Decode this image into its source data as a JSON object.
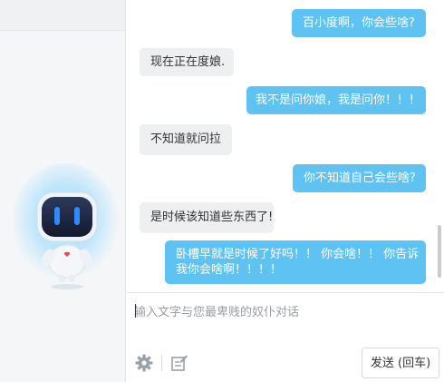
{
  "messages": [
    {
      "role": "user",
      "text": "百小度啊，你会些啥?"
    },
    {
      "role": "bot",
      "text": "现在正在度娘."
    },
    {
      "role": "user",
      "text": "我不是问你娘，我是问你！！！"
    },
    {
      "role": "bot",
      "text": "不知道就问拉"
    },
    {
      "role": "user",
      "text": "你不知道自己会些啥?"
    },
    {
      "role": "bot",
      "text": "是时候该知道些东西了!"
    },
    {
      "role": "user",
      "lines": [
        "卧槽早就是时候了好吗！！ 你会啥！！ 你告诉",
        "我你会啥啊！！！！"
      ]
    }
  ],
  "input": {
    "placeholder": "输入文字与您最卑贱的奴仆对话",
    "value": ""
  },
  "toolbar": {
    "settings_icon": "gear-icon",
    "edit_icon": "edit-icon",
    "send_label": "发送 (回车)"
  },
  "colors": {
    "user_bubble": "#5ec3f2",
    "bot_bubble": "#eeeff1",
    "robot_glow": "#8fd8ff",
    "robot_eyes": "#2f8cff"
  }
}
